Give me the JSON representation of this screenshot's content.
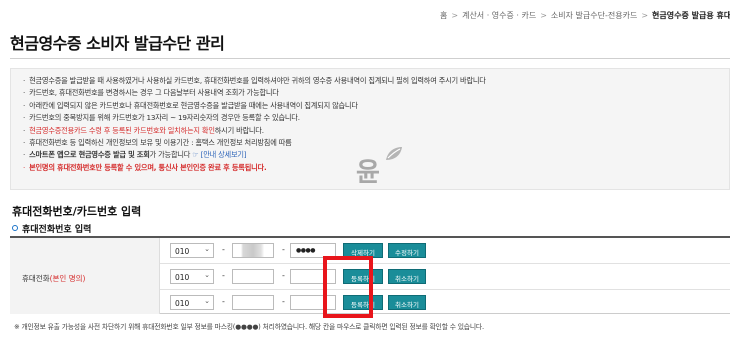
{
  "breadcrumb": {
    "items": [
      "홈",
      "계산서 · 영수증 · 카드",
      "소비자 발급수단-전용카드",
      "현금영수증 발급용 휴대전화번호"
    ],
    "separator": ">"
  },
  "page_title": "현금영수증 소비자 발급수단 관리",
  "notices": {
    "n1": "현금영수증을 발급받을 때 사용하였거나 사용하실 카드번호, 휴대전화번호를 입력하셔야만 귀하의 영수증 사용내역이 집계되니 필히 입력하여 주시기 바랍니다",
    "n2": "카드번호, 휴대전화번호를 변경하시는 경우 그 다음날부터 사용내역 조회가 가능합니다",
    "n3": "아래칸에 입력되지 않은 카드번호나 휴대전화번호로 현금영수증을 발급받을 때에는 사용내역이 집계되지 않습니다",
    "n4": "카드번호의 중복방지를 위해 카드번호가 13자리 ~ 19자리숫자의 경우만 등록할 수 있습니다.",
    "n5_red": "현금영수증전용카드 수령 후 등록된 카드번호와 일치하는지 확인",
    "n5_rest": "하시기 바랍니다.",
    "n6": "휴대전화번호 등 입력하신 개인정보의 보유 및 이용기간 : 홈택스 개인정보 처리방침에 따름",
    "n7_bold": "스마트폰 앱으로 현금영수증 발급 및 조회",
    "n7_rest": "가 가능합니다",
    "n7_link": "[안내 상세보기]",
    "n8": "본인명의 휴대전화번호만 등록할 수 있으며, 통신사 본인인증 완료 후 등록됩니다."
  },
  "watermark_text": "윤",
  "section_title": "휴대전화번호/카드번호 입력",
  "sub_title": "휴대전화번호 입력",
  "form": {
    "label": "휴대전화",
    "label_note": "(본인 명의)",
    "rows": [
      {
        "prefix": "010",
        "middle": "",
        "last": "●●●●",
        "btn1": "삭제하기",
        "btn2": "수정하기"
      },
      {
        "prefix": "010",
        "middle": "",
        "last": "",
        "btn1": "등록하기",
        "btn2": "취소하기"
      },
      {
        "prefix": "010",
        "middle": "",
        "last": "",
        "btn1": "등록하기",
        "btn2": "취소하기"
      }
    ],
    "dash": "-"
  },
  "footnote": "※ 개인정보 유출 가능성을 사전 차단하기 위해 휴대전화번호 일부 정보를 마스킹(●●●●) 처리하였습니다. 해당 칸을 마우스로 클릭하면 입력된 정보를 확인할 수 있습니다.",
  "colors": {
    "accent_button": "#1a8d99",
    "highlight_box": "#e8151b",
    "warning_text": "#d52b2b",
    "link": "#2a62b8"
  },
  "icons": {
    "chevron": "chevron-down-icon",
    "leaf": "leaf-icon",
    "info": "info-icon"
  }
}
